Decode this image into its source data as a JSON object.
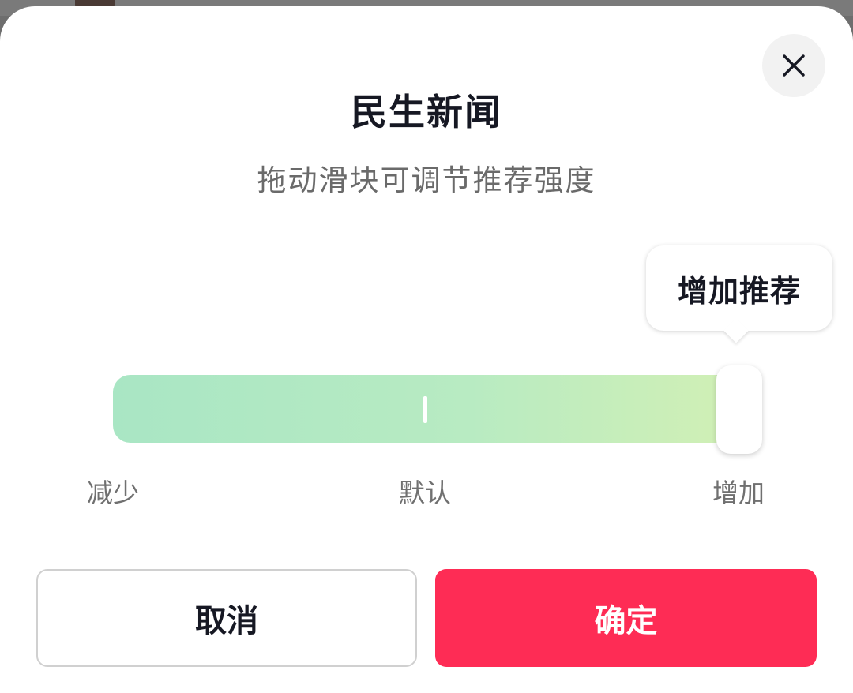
{
  "dialog": {
    "title": "民生新闻",
    "subtitle": "拖动滑块可调节推荐强度",
    "close_icon": "close-icon"
  },
  "slider": {
    "tooltip": "增加推荐",
    "value_fraction": 1.0,
    "scale_labels": {
      "min": "减少",
      "mid": "默认",
      "max": "增加"
    },
    "gradient_colors": [
      "#a9e6c4",
      "#d3f0b4"
    ]
  },
  "buttons": {
    "cancel_label": "取消",
    "confirm_label": "确定"
  },
  "colors": {
    "accent": "#fe2c55",
    "title_text": "#161823",
    "secondary_text": "#6a6a6a"
  }
}
